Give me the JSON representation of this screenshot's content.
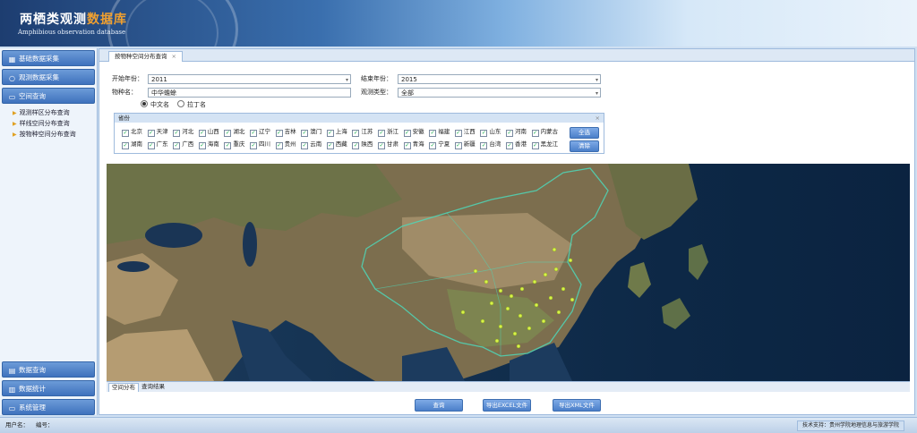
{
  "header": {
    "title_main": "两栖类观测",
    "title_accent": "数据库",
    "subtitle": "Amphibious observation database"
  },
  "sidebar": {
    "top_items": [
      {
        "label": "基础数据采集",
        "icon": "grid-icon"
      },
      {
        "label": "观测数据采集",
        "icon": "circle-icon"
      },
      {
        "label": "空间查询",
        "icon": "monitor-icon"
      }
    ],
    "sub_items": [
      "观测样区分布查询",
      "样线空间分布查询",
      "按物种空间分布查询"
    ],
    "bottom_items": [
      {
        "label": "数据查询",
        "icon": "table-icon"
      },
      {
        "label": "数据统计",
        "icon": "chart-icon"
      },
      {
        "label": "系统管理",
        "icon": "monitor-icon"
      }
    ]
  },
  "tab": {
    "label": "按物种空间分布查询",
    "close": "×"
  },
  "form": {
    "start_year_label": "开始年份：",
    "start_year_value": "2011",
    "end_year_label": "结束年份：",
    "end_year_value": "2015",
    "species_label": "物种名：",
    "species_value": "中华蟾蜍",
    "obs_type_label": "观测类型：",
    "obs_type_value": "全部",
    "name_options": [
      "中文名",
      "拉丁名"
    ]
  },
  "provinces": {
    "title": "省份",
    "close": "×",
    "row1": [
      "北京",
      "天津",
      "河北",
      "山西",
      "湖北",
      "辽宁",
      "吉林",
      "澳门",
      "上海",
      "江苏",
      "浙江",
      "安徽",
      "福建",
      "江西",
      "山东",
      "河南",
      "内蒙古"
    ],
    "row2": [
      "湖南",
      "广东",
      "广西",
      "海南",
      "重庆",
      "四川",
      "贵州",
      "云南",
      "西藏",
      "陕西",
      "甘肃",
      "青海",
      "宁夏",
      "新疆",
      "台湾",
      "香港",
      "黑龙江"
    ],
    "select_all": "全选",
    "clear": "清除"
  },
  "map_tabs": [
    "空间分布",
    "查询结果"
  ],
  "actions": {
    "query": "查询",
    "export_excel": "导出EXCEL文件",
    "export_xml": "导出XML文件"
  },
  "footer": {
    "user_label": "用户名：",
    "id_label": "编号：",
    "tech_support": "技术支持：贵州学院地理信息与旅游学院"
  }
}
